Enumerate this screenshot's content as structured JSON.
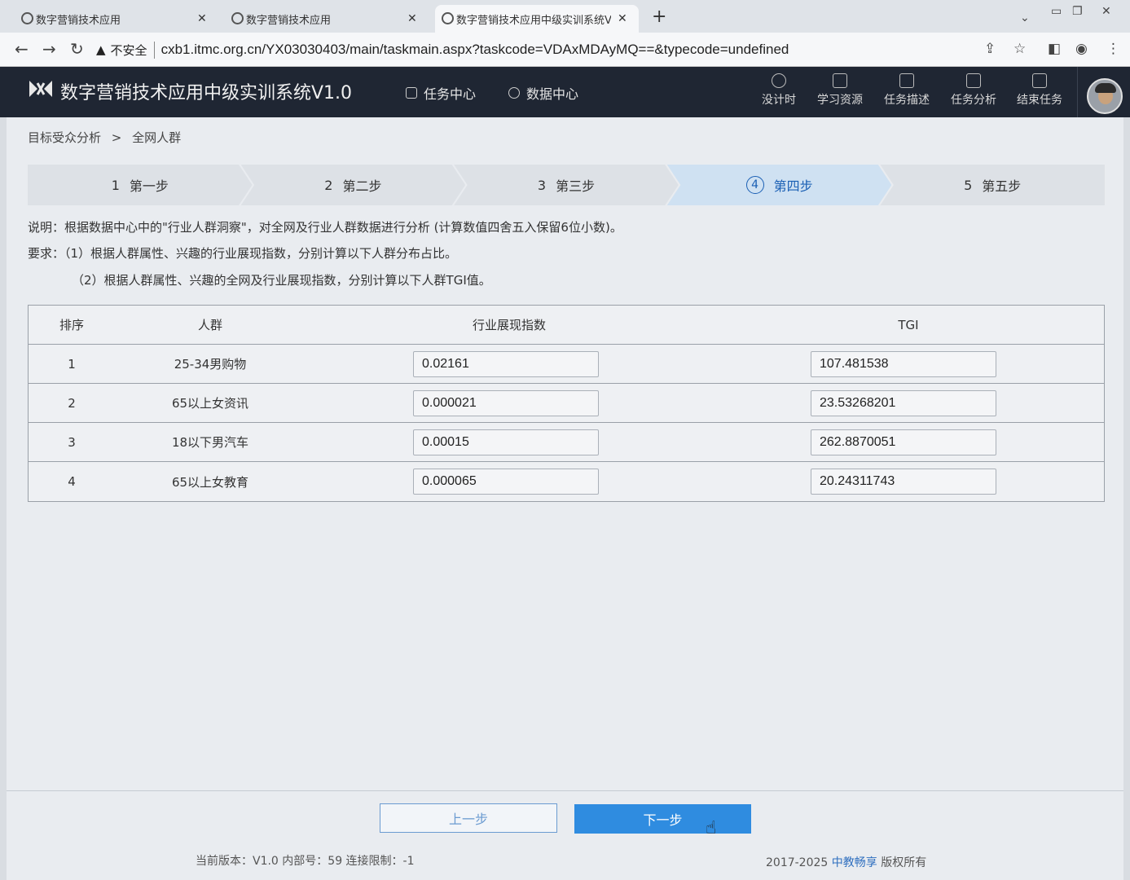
{
  "browser": {
    "tabs": [
      {
        "title": "数字营销技术应用"
      },
      {
        "title": "数字营销技术应用"
      },
      {
        "title": "数字营销技术应用中级实训系统V"
      }
    ],
    "insecure_label": "不安全",
    "url": "cxb1.itmc.org.cn/YX03030403/main/taskmain.aspx?taskcode=VDAxMDAyMQ==&typecode=undefined"
  },
  "header": {
    "title": "数字营销技术应用中级实训系统V1.0",
    "nav": [
      {
        "label": "任务中心"
      },
      {
        "label": "数据中心"
      }
    ],
    "tools": [
      {
        "label": "没计时",
        "icon": "clock-icon"
      },
      {
        "label": "学习资源",
        "icon": "book-icon"
      },
      {
        "label": "任务描述",
        "icon": "document-icon"
      },
      {
        "label": "任务分析",
        "icon": "chart-icon"
      },
      {
        "label": "结束任务",
        "icon": "exit-icon"
      }
    ]
  },
  "breadcrumb": {
    "parent": "目标受众分析",
    "separator": ">",
    "current": "全网人群"
  },
  "steps": [
    {
      "num": "1",
      "label": "第一步",
      "active": false
    },
    {
      "num": "2",
      "label": "第二步",
      "active": false
    },
    {
      "num": "3",
      "label": "第三步",
      "active": false
    },
    {
      "num": "4",
      "label": "第四步",
      "active": true
    },
    {
      "num": "5",
      "label": "第五步",
      "active": false
    }
  ],
  "description": {
    "line1": "说明：根据数据中心中的\"行业人群洞察\"，对全网及行业人群数据进行分析 (计算数值四舍五入保留6位小数)。",
    "line2": "要求：（1）根据人群属性、兴趣的行业展现指数，分别计算以下人群分布占比。",
    "line3": "（2）根据人群属性、兴趣的全网及行业展现指数，分别计算以下人群TGI值。"
  },
  "table": {
    "headers": {
      "rank": "排序",
      "group": "人群",
      "index": "行业展现指数",
      "tgi": "TGI"
    },
    "rows": [
      {
        "rank": "1",
        "group": "25-34男购物",
        "index": "0.02161",
        "tgi": "107.481538"
      },
      {
        "rank": "2",
        "group": "65以上女资讯",
        "index": "0.000021",
        "tgi": "23.53268201"
      },
      {
        "rank": "3",
        "group": "18以下男汽车",
        "index": "0.00015",
        "tgi": "262.8870051"
      },
      {
        "rank": "4",
        "group": "65以上女教育",
        "index": "0.000065",
        "tgi": "20.24311743"
      }
    ]
  },
  "buttons": {
    "prev": "上一步",
    "next": "下一步"
  },
  "footer": {
    "version": "当前版本：V1.0 内部号：59 连接限制：-1",
    "copyright_prefix": "2017-2025",
    "brand": "中教畅享",
    "copyright_suffix": "版权所有"
  }
}
